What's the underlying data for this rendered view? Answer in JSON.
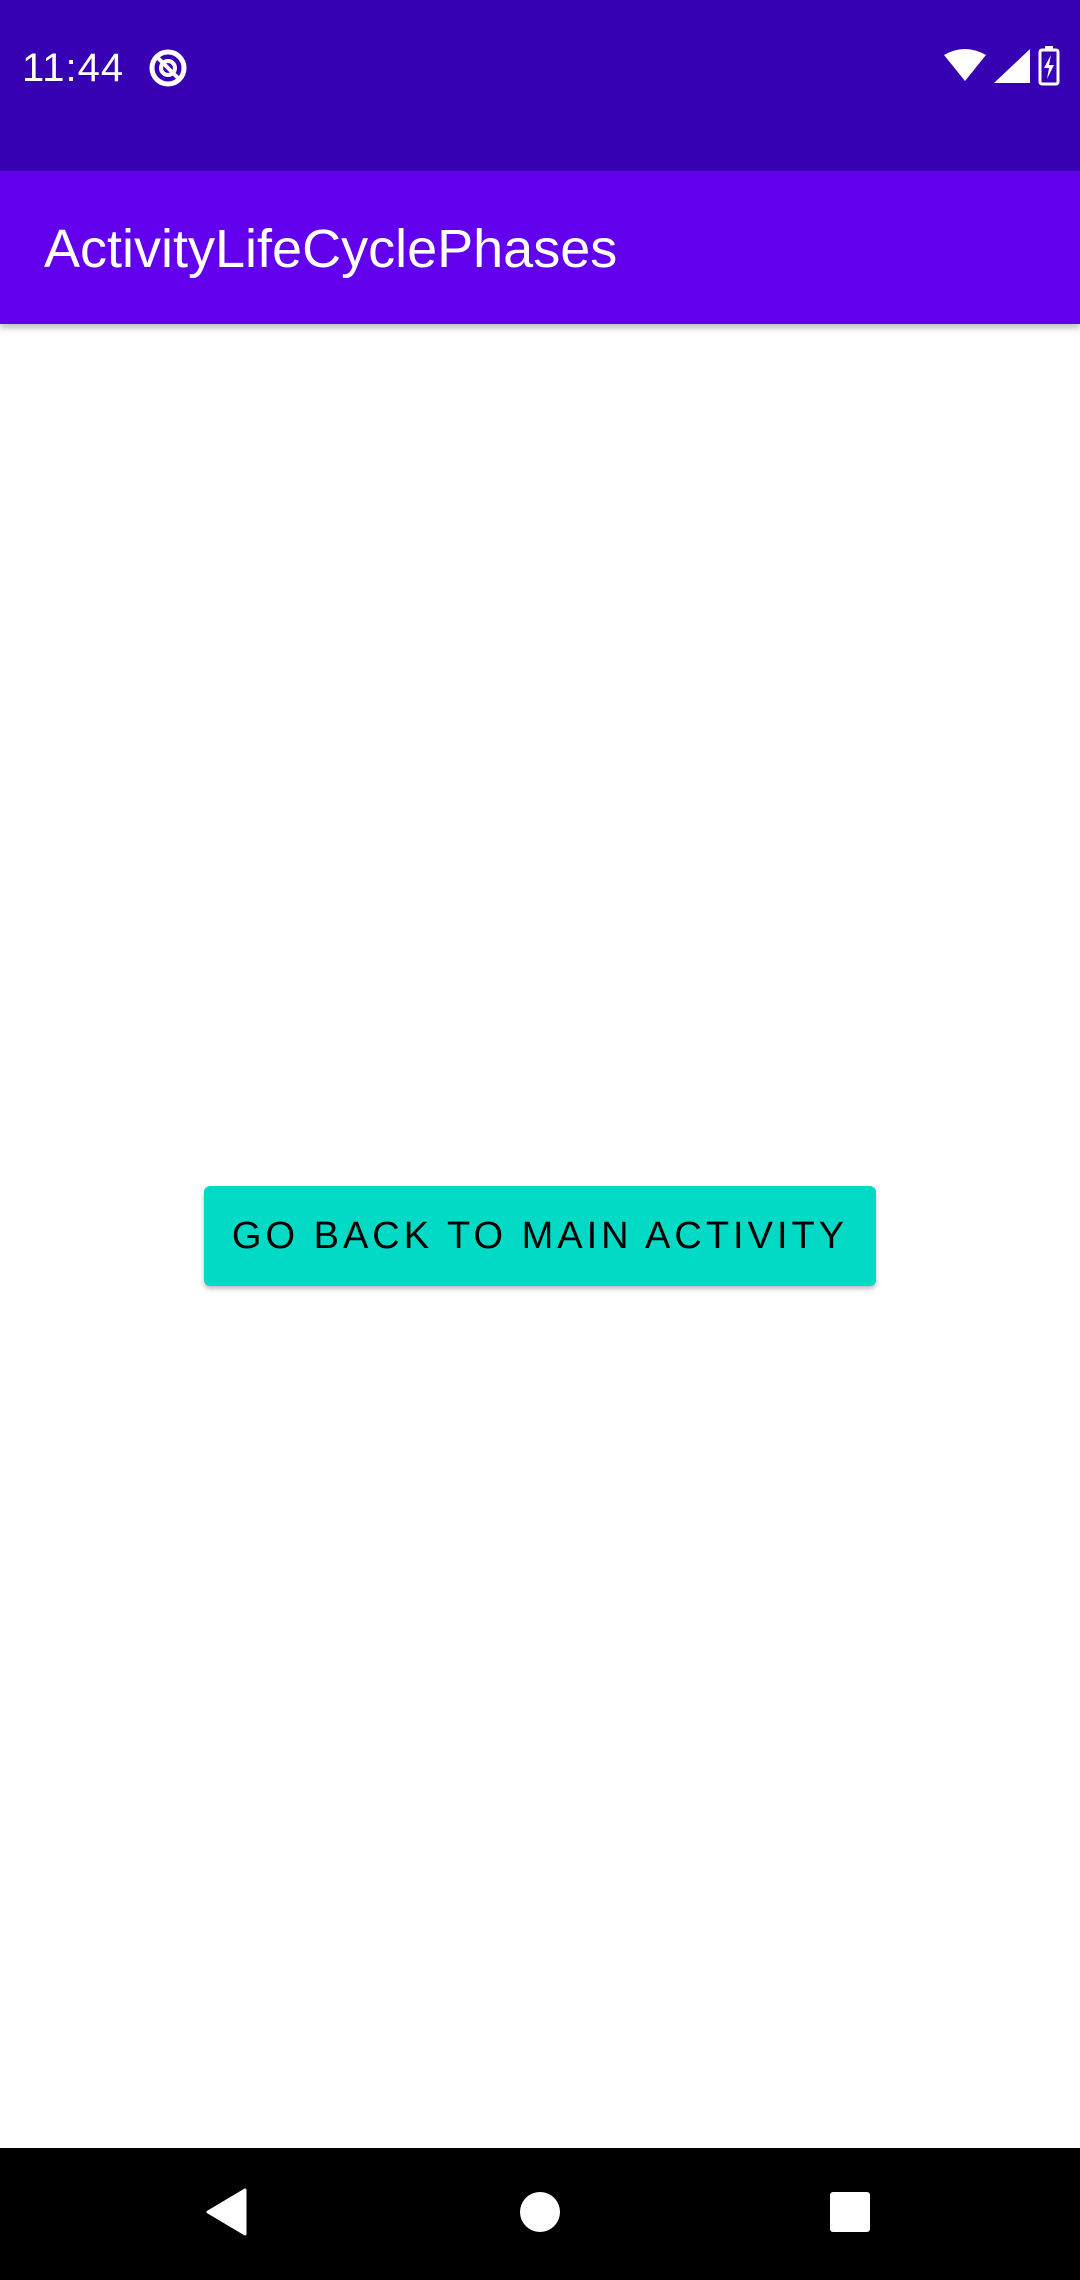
{
  "status_bar": {
    "time": "11:44",
    "app_icon": "do-not-disturb-icon",
    "icons": [
      "wifi-icon",
      "cell-signal-icon",
      "battery-charging-icon"
    ],
    "background_color": "#3700b3"
  },
  "app_bar": {
    "title": "ActivityLifeCyclePhases",
    "background_color": "#6200ee"
  },
  "main": {
    "button_label": "GO BACK TO MAIN ACTIVITY",
    "button_color": "#03dac5"
  },
  "nav_bar": {
    "buttons": [
      "back-icon",
      "home-icon",
      "recents-icon"
    ]
  }
}
